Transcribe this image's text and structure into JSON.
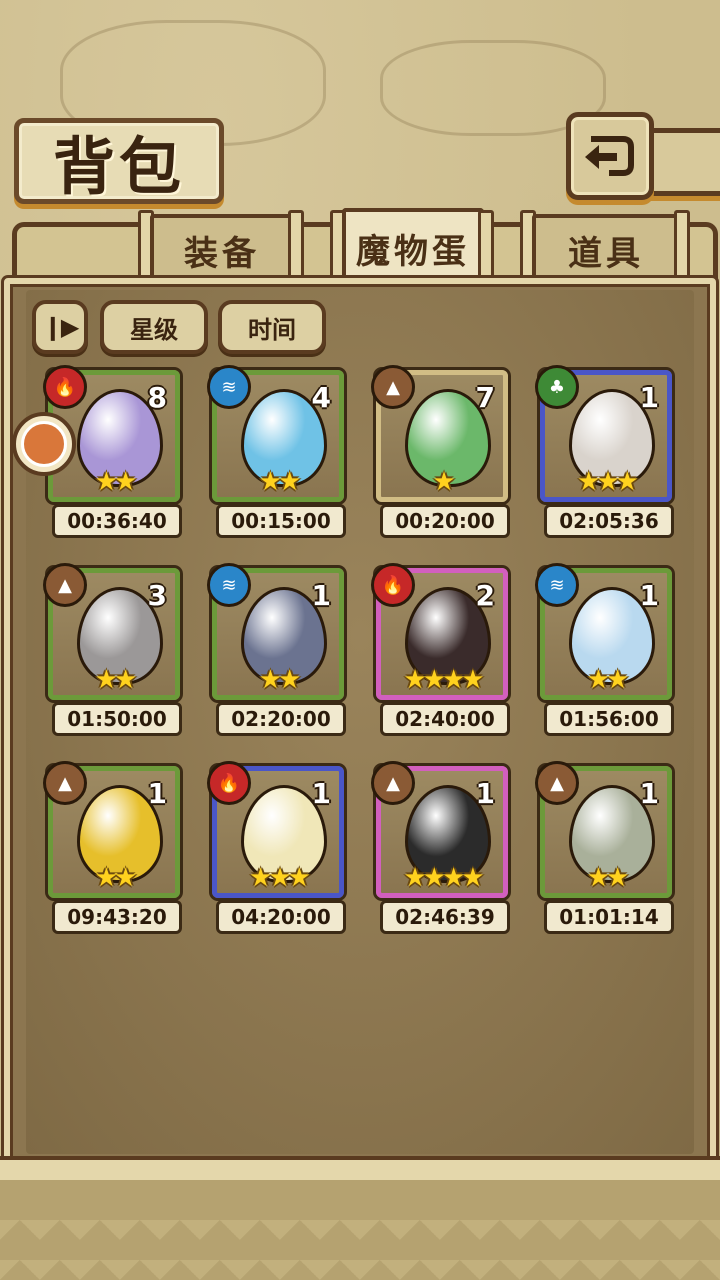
{
  "header": {
    "title": "背包",
    "back_icon": "back-arrow-icon"
  },
  "tabs": [
    {
      "label": "装备",
      "active": false
    },
    {
      "label": "魔物蛋",
      "active": true
    },
    {
      "label": "道具",
      "active": false
    }
  ],
  "sort": {
    "toggle_icon": "sort-toggle-icon",
    "star_label": "星级",
    "time_label": "时间"
  },
  "side_button_icon": "up-arrow-icon",
  "eggs": [
    {
      "element": "fire",
      "count": "8",
      "stars": "★★",
      "rarity": "green",
      "timer": "00:36:40",
      "color": "#a996d6"
    },
    {
      "element": "water",
      "count": "4",
      "stars": "★★",
      "rarity": "green",
      "timer": "00:15:00",
      "color": "#6fc2e6"
    },
    {
      "element": "earth",
      "count": "7",
      "stars": "★",
      "rarity": "tan",
      "timer": "00:20:00",
      "color": "#6bb86a"
    },
    {
      "element": "wood",
      "count": "1",
      "stars": "★★★",
      "rarity": "blue",
      "timer": "02:05:36",
      "color": "#d9d3cc"
    },
    {
      "element": "earth",
      "count": "3",
      "stars": "★★",
      "rarity": "green",
      "timer": "01:50:00",
      "color": "#9b9898"
    },
    {
      "element": "water",
      "count": "1",
      "stars": "★★",
      "rarity": "green",
      "timer": "02:20:00",
      "color": "#6b7390"
    },
    {
      "element": "fire",
      "count": "2",
      "stars": "★★★★",
      "rarity": "pink",
      "timer": "02:40:00",
      "color": "#3a2b2b"
    },
    {
      "element": "water",
      "count": "1",
      "stars": "★★",
      "rarity": "green",
      "timer": "01:56:00",
      "color": "#b9d9ef"
    },
    {
      "element": "earth",
      "count": "1",
      "stars": "★★",
      "rarity": "green",
      "timer": "09:43:20",
      "color": "#e6bf2b"
    },
    {
      "element": "fire",
      "count": "1",
      "stars": "★★★",
      "rarity": "blue",
      "timer": "04:20:00",
      "color": "#f0e7b8"
    },
    {
      "element": "earth",
      "count": "1",
      "stars": "★★★★",
      "rarity": "pink",
      "timer": "02:46:39",
      "color": "#2b2b2b"
    },
    {
      "element": "earth",
      "count": "1",
      "stars": "★★",
      "rarity": "green",
      "timer": "01:01:14",
      "color": "#a9b09a"
    }
  ]
}
